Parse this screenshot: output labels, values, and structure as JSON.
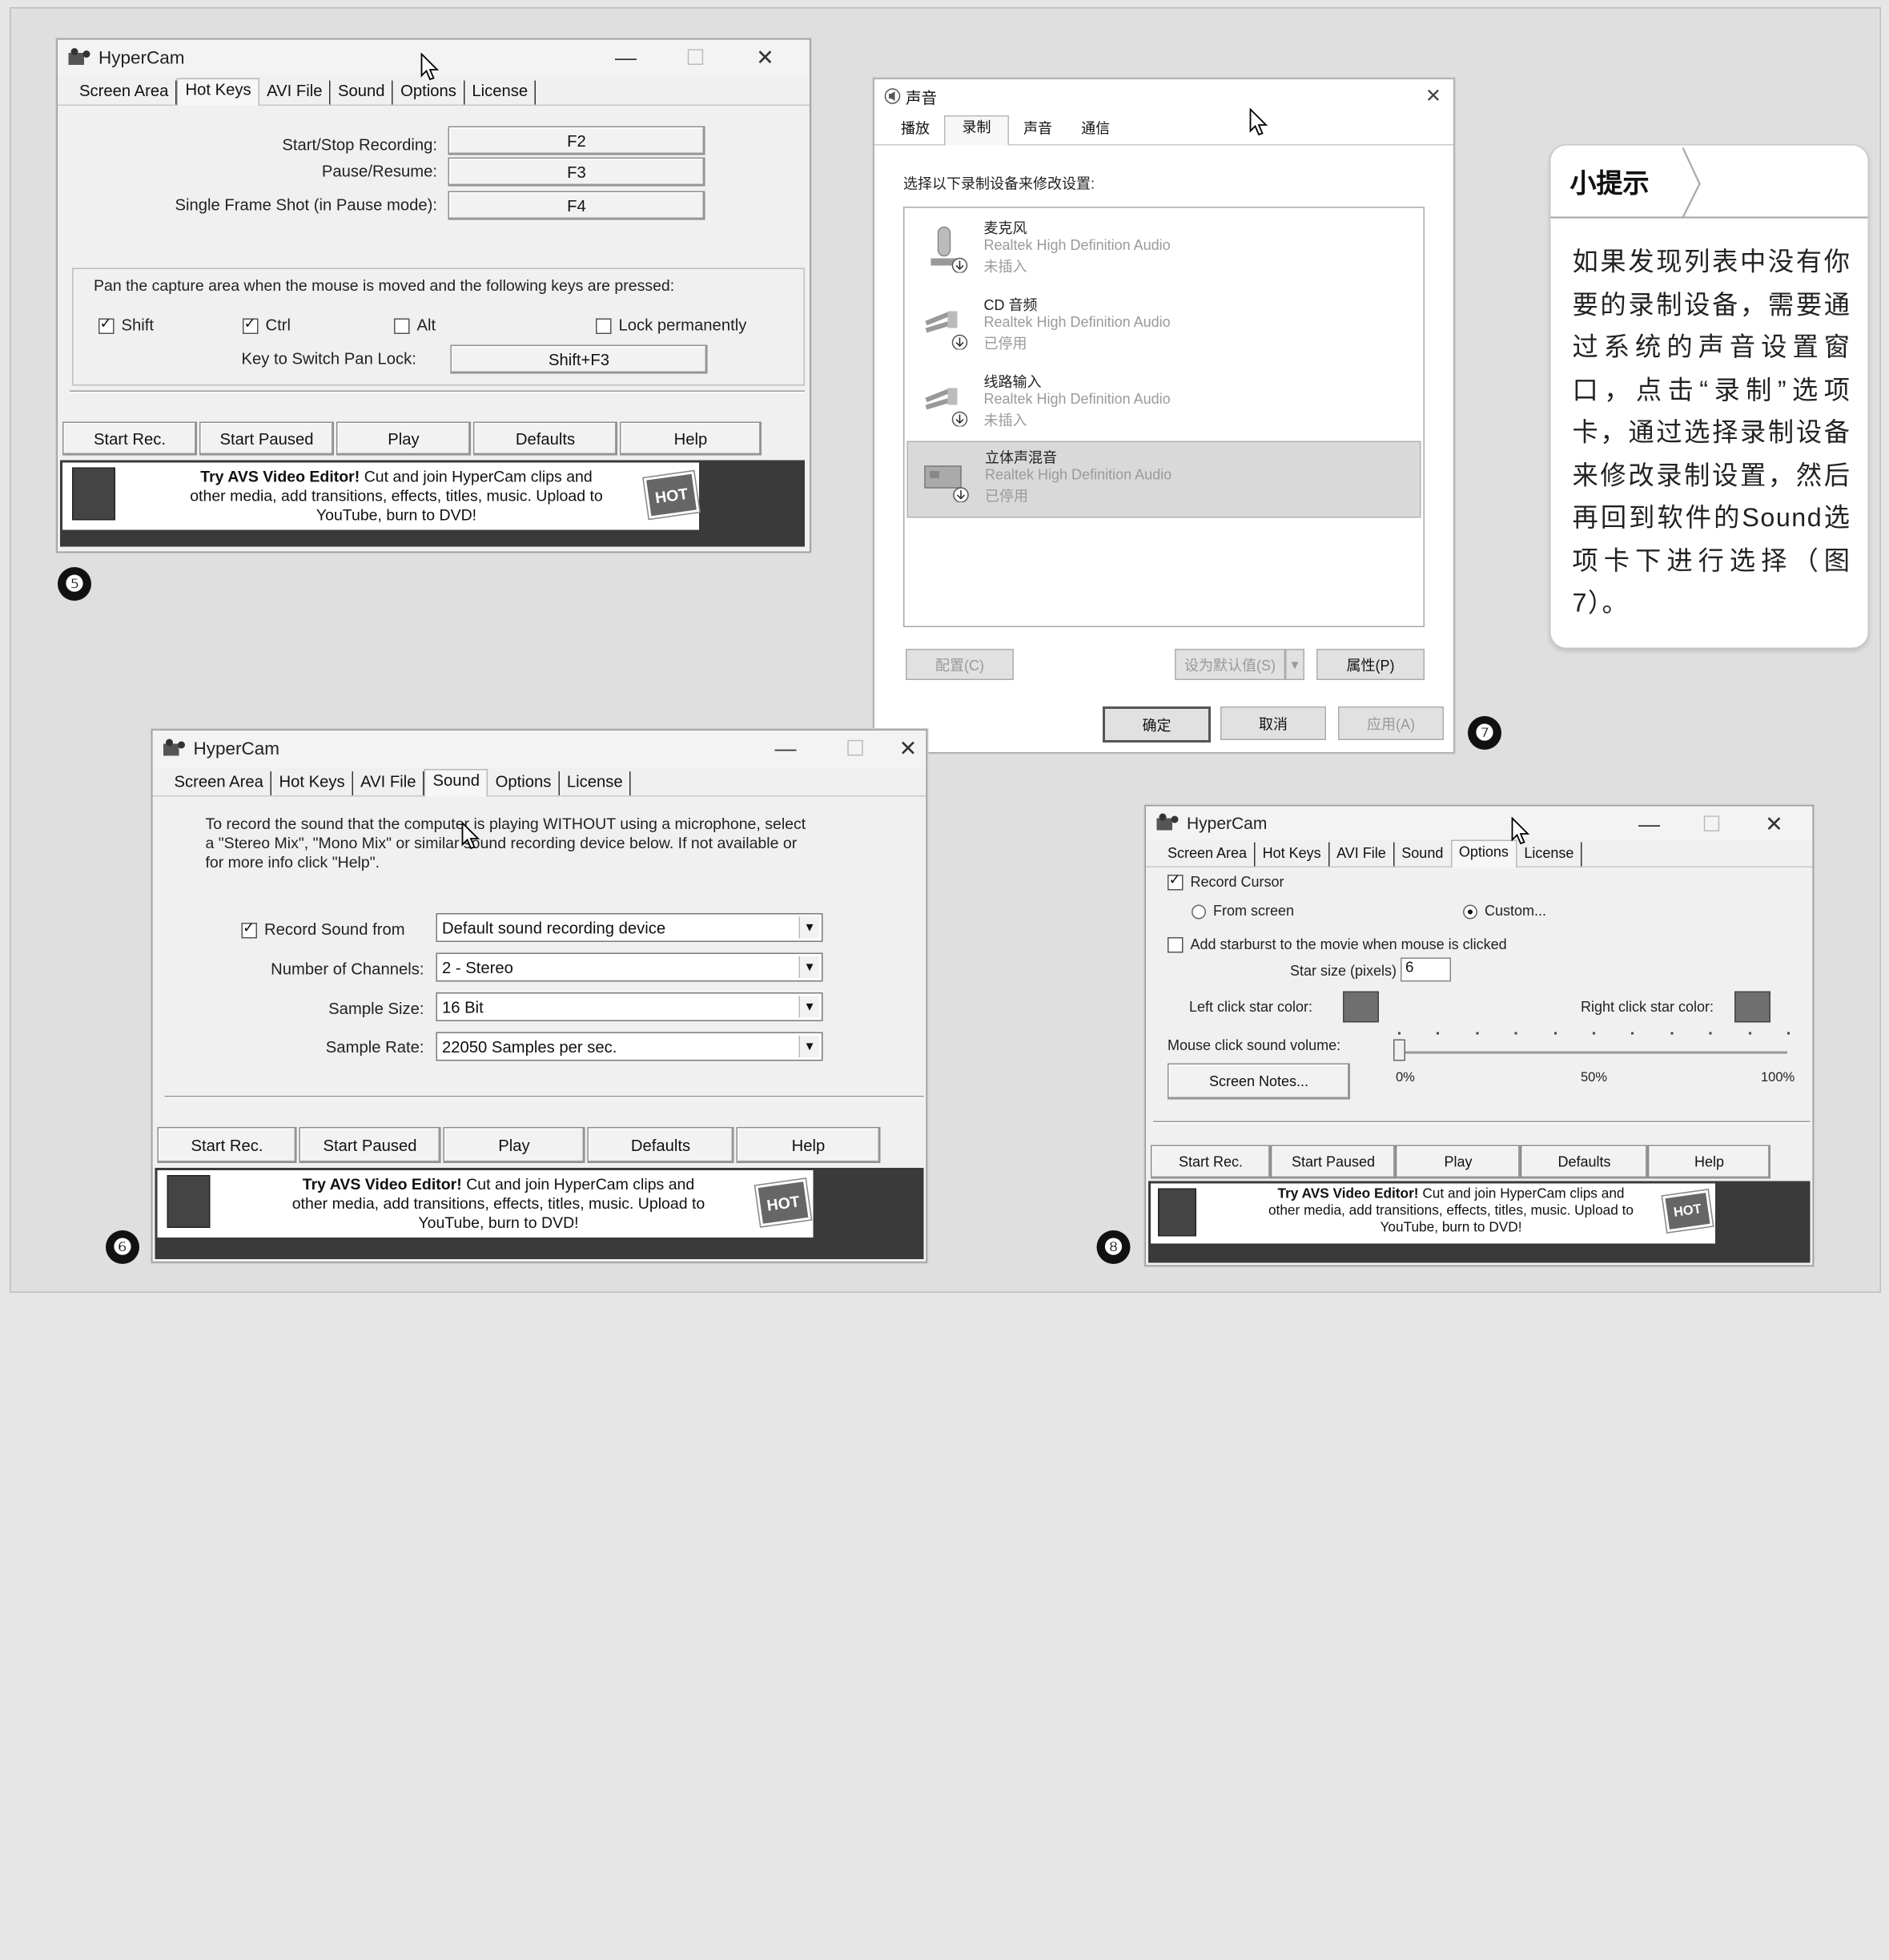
{
  "figure5": {
    "badge": "❺",
    "title": "HyperCam",
    "tabs": [
      "Screen Area",
      "Hot Keys",
      "AVI File",
      "Sound",
      "Options",
      "License"
    ],
    "active_tab": "Hot Keys",
    "hotkeys": [
      {
        "label": "Start/Stop Recording:",
        "key": "F2"
      },
      {
        "label": "Pause/Resume:",
        "key": "F3"
      },
      {
        "label": "Single Frame Shot (in Pause mode):",
        "key": "F4"
      }
    ],
    "pan_text": "Pan the capture area when the mouse is moved and the following keys are pressed:",
    "pan_keys": [
      {
        "label": "Shift",
        "checked": true
      },
      {
        "label": "Ctrl",
        "checked": true
      },
      {
        "label": "Alt",
        "checked": false
      },
      {
        "label": "Lock permanently",
        "checked": false
      }
    ],
    "switch_label": "Key to Switch Pan Lock:",
    "switch_key": "Shift+F3"
  },
  "figure6": {
    "badge": "❻",
    "title": "HyperCam",
    "tabs": [
      "Screen Area",
      "Hot Keys",
      "AVI File",
      "Sound",
      "Options",
      "License"
    ],
    "active_tab": "Sound",
    "info_line1": "To record the sound that the computer is playing WITHOUT using a microphone, select",
    "info_line2": "a \"Stereo Mix\", \"Mono Mix\" or similar sound recording device below. If not available or",
    "info_line3": "for more info click \"Help\".",
    "record_label": "Record Sound from",
    "record_checked": true,
    "record_value": "Default sound recording device",
    "channels_label": "Number of Channels:",
    "channels_value": "2 - Stereo",
    "sample_size_label": "Sample Size:",
    "sample_size_value": "16 Bit",
    "sample_rate_label": "Sample Rate:",
    "sample_rate_value": "22050 Samples per sec."
  },
  "figure7": {
    "badge": "❼",
    "title": "声音",
    "tabs": [
      "播放",
      "录制",
      "声音",
      "通信"
    ],
    "active_tab": "录制",
    "instruction": "选择以下录制设备来修改设置:",
    "devices": [
      {
        "name": "麦克风",
        "driver": "Realtek High Definition Audio",
        "status": "未插入"
      },
      {
        "name": "CD 音频",
        "driver": "Realtek High Definition Audio",
        "status": "已停用"
      },
      {
        "name": "线路输入",
        "driver": "Realtek High Definition Audio",
        "status": "未插入"
      },
      {
        "name": "立体声混音",
        "driver": "Realtek High Definition Audio",
        "status": "已停用"
      }
    ],
    "configure": "配置(C)",
    "set_default": "设为默认值(S)",
    "properties": "属性(P)",
    "ok": "确定",
    "cancel": "取消",
    "apply": "应用(A)"
  },
  "figure8": {
    "badge": "❽",
    "title": "HyperCam",
    "tabs": [
      "Screen Area",
      "Hot Keys",
      "AVI File",
      "Sound",
      "Options",
      "License"
    ],
    "active_tab": "Options",
    "record_cursor": "Record Cursor",
    "from_screen": "From screen",
    "custom": "Custom...",
    "starburst": "Add starburst to the movie when mouse is clicked",
    "star_size_label": "Star size (pixels)",
    "star_size_value": "6",
    "left_star": "Left click star color:",
    "right_star": "Right click star color:",
    "volume_label": "Mouse click sound volume:",
    "volume_value": 0,
    "vol_ticks": [
      "0%",
      "50%",
      "100%"
    ],
    "screen_notes": "Screen Notes..."
  },
  "common": {
    "buttons": [
      "Start Rec.",
      "Start Paused",
      "Play",
      "Defaults",
      "Help"
    ],
    "ad_title": "Try AVS Video Editor!",
    "ad_line1": " Cut and join HyperCam clips and",
    "ad_line2": "other media, add transitions, effects, titles, music. Upload to",
    "ad_line3": "YouTube, burn to DVD!",
    "hot": "HOT"
  },
  "tip": {
    "title": "小提示",
    "body": "如果发现列表中没有你要的录制设备，需要通过系统的声音设置窗口，点击“录制”选项卡，通过选择录制设备来修改录制设置，然后再回到软件的Sound选项卡下进行选择（图7）。"
  }
}
